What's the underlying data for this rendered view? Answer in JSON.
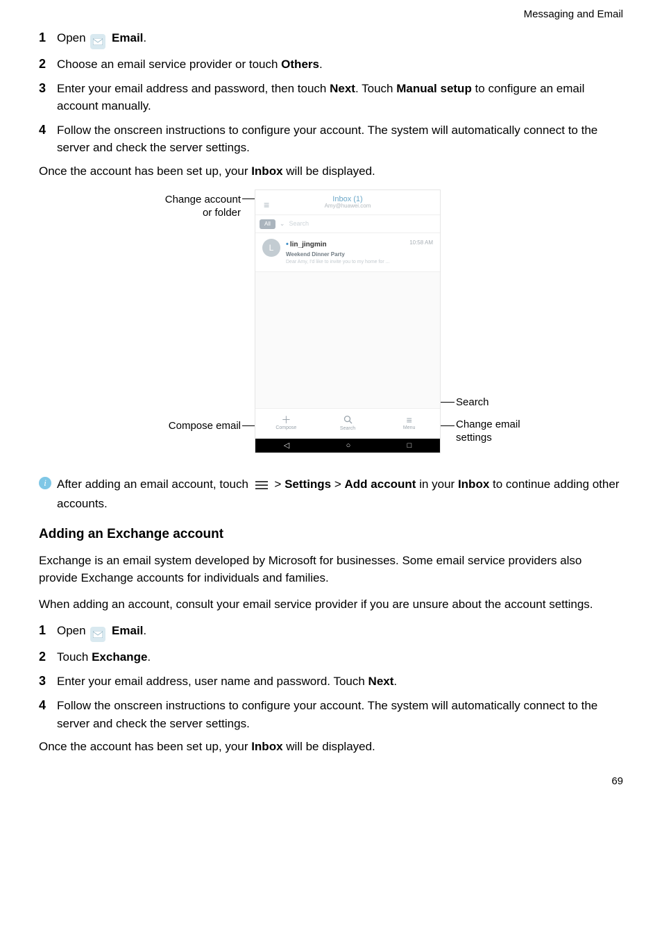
{
  "header": {
    "section": "Messaging and Email"
  },
  "steps1": [
    {
      "n": "1",
      "pre": "Open ",
      "bold1": "Email",
      "post": ".",
      "icon": true
    },
    {
      "n": "2",
      "pre": "Choose an email service provider or touch ",
      "bold1": "Others",
      "post": "."
    },
    {
      "n": "3",
      "pre": "Enter your email address and password, then touch ",
      "bold1": "Next",
      "mid": ". Touch ",
      "bold2": "Manual setup",
      "post": " to configure an email account manually."
    },
    {
      "n": "4",
      "pre": "Follow the onscreen instructions to configure your account. The system will automatically connect to the server and check the server settings.",
      "bold1": "",
      "post": ""
    }
  ],
  "outro1_pre": "Once the account has been set up, your ",
  "outro1_bold": "Inbox",
  "outro1_post": " will be displayed.",
  "figure": {
    "labels": {
      "change_account": "Change account\nor folder",
      "compose": "Compose email",
      "search": "Search",
      "change_settings": "Change email\nsettings"
    },
    "screen": {
      "title": "Inbox (1)",
      "subtitle": "Amy@huawei.com",
      "filter_chip": "All",
      "search_placeholder": "Search",
      "mail": {
        "avatar_letter": "L",
        "sender": "lin_jingmin",
        "time": "10:58 AM",
        "subject": "Weekend Dinner Party",
        "snippet": "Dear Amy,   I'd like to invite you to my home for ..."
      },
      "tabs": {
        "compose": "Compose",
        "search": "Search",
        "menu": "Menu"
      }
    }
  },
  "info": {
    "pre": "After adding an email account, touch ",
    "gt": " > ",
    "b1": "Settings",
    "b2": "Add account",
    "mid": " in your ",
    "b3": "Inbox",
    "post": " to continue adding other accounts."
  },
  "h2": "Adding an Exchange account",
  "p2": "Exchange is an email system developed by Microsoft for businesses. Some email service providers also provide Exchange accounts for individuals and families.",
  "p3": "When adding an account, consult your email service provider if you are unsure about the account settings.",
  "steps2": [
    {
      "n": "1",
      "pre": "Open ",
      "bold1": "Email",
      "post": ".",
      "icon": true
    },
    {
      "n": "2",
      "pre": "Touch ",
      "bold1": "Exchange",
      "post": "."
    },
    {
      "n": "3",
      "pre": "Enter your email address, user name and password. Touch ",
      "bold1": "Next",
      "post": "."
    },
    {
      "n": "4",
      "pre": "Follow the onscreen instructions to configure your account. The system will automatically connect to the server and check the server settings.",
      "bold1": "",
      "post": ""
    }
  ],
  "outro2_pre": "Once the account has been set up, your ",
  "outro2_bold": "Inbox",
  "outro2_post": " will be displayed.",
  "page_number": "69"
}
